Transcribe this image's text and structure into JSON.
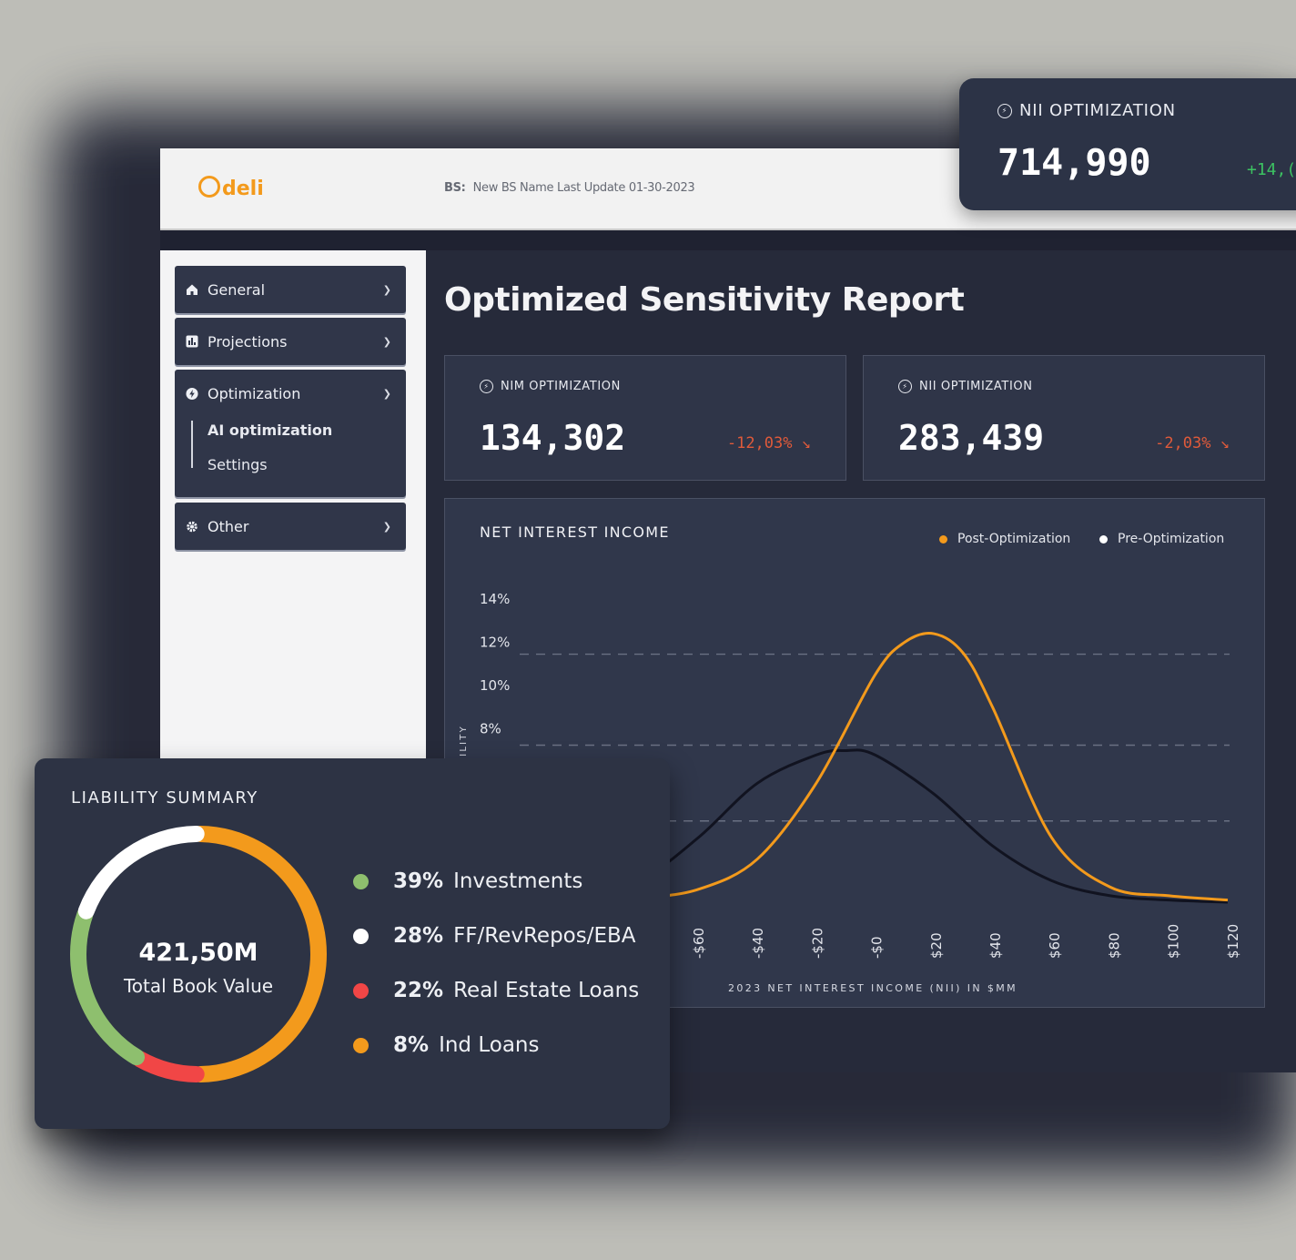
{
  "app": {
    "logo_text": "deli"
  },
  "topbar": {
    "bs_label": "BS:",
    "bs_info": "New BS Name Last Update 01-30-2023"
  },
  "sidebar": {
    "items": [
      {
        "label": "General",
        "icon": "home-icon"
      },
      {
        "label": "Projections",
        "icon": "bar-chart-icon"
      },
      {
        "label": "Optimization",
        "icon": "bolt-icon",
        "expanded": true,
        "children": [
          {
            "label": "AI optimization",
            "active": true
          },
          {
            "label": "Settings"
          }
        ]
      },
      {
        "label": "Other",
        "icon": "gear-icon"
      }
    ]
  },
  "main": {
    "title": "Optimized Sensitivity Report"
  },
  "kpis": [
    {
      "title": "NIM OPTIMIZATION",
      "value": "134,302",
      "delta": "-12,03%"
    },
    {
      "title": "NII OPTIMIZATION",
      "value": "283,439",
      "delta": "-2,03%"
    }
  ],
  "floating_kpi": {
    "title": "NII OPTIMIZATION",
    "value": "714,990",
    "delta": "+14,("
  },
  "chart_card": {
    "title": "NET INTEREST INCOME",
    "legend": [
      {
        "label": "Post-Optimization",
        "color": "#f39a1c"
      },
      {
        "label": "Pre-Optimization",
        "color": "#ffffff"
      }
    ],
    "ylabel_visible": "OBABILITY",
    "xlabel": "2023 NET INTEREST INCOME (NII) IN $MM"
  },
  "chart_data": {
    "type": "line",
    "title": "NET INTEREST INCOME",
    "xlabel": "2023 NET INTEREST INCOME (NII) IN $MM",
    "ylabel": "",
    "y_ticks": [
      "14%",
      "12%",
      "10%",
      "8%"
    ],
    "x_ticks": [
      "-$60",
      "-$40",
      "-$20",
      "-$0",
      "$20",
      "$40",
      "$60",
      "$80",
      "$100",
      "$120"
    ],
    "xlim": [
      -120,
      120
    ],
    "ylim": [
      0,
      14
    ],
    "series": [
      {
        "name": "Post-Optimization",
        "color": "#f39a1c",
        "x": [
          -120,
          -100,
          -80,
          -60,
          -40,
          -20,
          0,
          10,
          20,
          30,
          40,
          60,
          80,
          100,
          120
        ],
        "y": [
          0.0,
          0.1,
          0.2,
          0.6,
          2.0,
          5.5,
          10.5,
          12.0,
          12.4,
          11.5,
          9.0,
          3.0,
          0.7,
          0.3,
          0.1
        ]
      },
      {
        "name": "Pre-Optimization",
        "color": "#111320",
        "x": [
          -120,
          -100,
          -80,
          -60,
          -40,
          -20,
          -10,
          0,
          20,
          40,
          60,
          80,
          100,
          120
        ],
        "y": [
          0.0,
          0.3,
          1.0,
          3.0,
          5.5,
          6.8,
          7.0,
          6.8,
          5.0,
          2.6,
          1.0,
          0.3,
          0.1,
          0.0
        ]
      }
    ],
    "grid": true,
    "legend_position": "top-right"
  },
  "liability": {
    "title": "LIABILITY SUMMARY",
    "total_value": "421,50M",
    "total_label": "Total Book Value",
    "items": [
      {
        "pct": "39%",
        "label": "Investments",
        "color": "#8ebf6e"
      },
      {
        "pct": "28%",
        "label": "FF/RevRepos/EBA",
        "color": "#ffffff"
      },
      {
        "pct": "22%",
        "label": "Real Estate Loans",
        "color": "#f14646"
      },
      {
        "pct": "8%",
        "label": "Ind Loans",
        "color": "#f39a1c"
      }
    ]
  }
}
